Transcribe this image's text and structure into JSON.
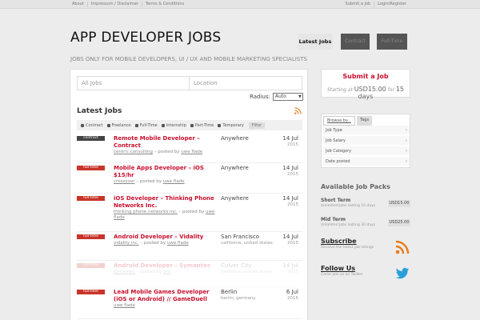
{
  "topbar": {
    "left_links": [
      "About",
      "Impressum / Disclaimer",
      "Terms & Conditions"
    ],
    "right_links": [
      "Submit a Job",
      "Login/Register"
    ]
  },
  "header": {
    "title": "APP DEVELOPER JOBS",
    "tagline": "JOBS ONLY FOR MOBILE DEVELOPERS, UI / UX AND MOBILE MARKETING SPECIALISTS",
    "nav": [
      "Latest Jobs",
      "Contract",
      "Full-Time"
    ]
  },
  "search": {
    "keyword_placeholder": "All Jobs",
    "location_placeholder": "Location",
    "radius_label": "Radius:",
    "radius_value": "Auto"
  },
  "listing": {
    "heading": "Latest Jobs",
    "filters": [
      "Contract",
      "Freelance",
      "Full-Time",
      "Internship",
      "Part-Time",
      "Temporary"
    ],
    "filter_button": "Filter",
    "jobs": [
      {
        "type": "contract",
        "title": "Remote Mobile Developer – Contract",
        "company": "centric consulting",
        "posted_by": "uwe flade",
        "location": "Anywhere",
        "location_detail": "",
        "date": "14 Jul",
        "year": "2015",
        "faded": false
      },
      {
        "type": "full-time",
        "title": "Mobile Apps Developer – iOS $15/hr",
        "company": "crossover",
        "posted_by": "uwe flade",
        "location": "Anywhere",
        "location_detail": "",
        "date": "14 Jul",
        "year": "2015",
        "faded": false
      },
      {
        "type": "full-time",
        "title": "iOS Developer – Thinking Phone Networks Inc.",
        "company": "thinking phone networks inc.",
        "posted_by": "uwe flade",
        "location": "Anywhere",
        "location_detail": "",
        "date": "14 Jul",
        "year": "2015",
        "faded": false
      },
      {
        "type": "full-time",
        "title": "Android Developer – Vidality",
        "company": "vidality inc.",
        "posted_by": "uwe flade",
        "location": "San Francisco",
        "location_detail": "california, united states",
        "date": "14 Jul",
        "year": "2015",
        "faded": false
      },
      {
        "type": "full-time",
        "title": "Android Developer – Symantec",
        "company": "symantec",
        "posted_by": "tim",
        "location": "Culver City",
        "location_detail": "california, united states",
        "date": "14 Jul",
        "year": "2015",
        "faded": true
      },
      {
        "type": "full-time",
        "title": "Lead Mobile Games Developer (iOS or Android) // GameDuell",
        "company": "",
        "posted_by": "uwe flade",
        "location": "Berlin",
        "location_detail": "berlin, germany",
        "date": "6 Jul",
        "year": "2015",
        "faded": false
      }
    ]
  },
  "sidebar": {
    "submit_title": "Submit a Job",
    "submit_starting": "Starting at",
    "submit_price": "USD15.00",
    "submit_for": "for",
    "submit_days": "15 days",
    "browse_tabs": [
      "Browse by...",
      "Tags"
    ],
    "browse_rows": [
      "Job Type",
      "Job Salary",
      "Job Category",
      "Date posted"
    ],
    "packs_heading": "Available Job Packs",
    "packs": [
      {
        "name": "Short Term",
        "desc": "Unlimited Jobs lasting 15 days",
        "price": "USD15.00"
      },
      {
        "name": "Mid Term",
        "desc": "Unlimited Jobs lasting 30 days",
        "price": "USD25.00"
      }
    ],
    "subscribe_heading": "Subscribe",
    "subscribe_desc": "Receive the latest job listings",
    "follow_heading": "Follow Us",
    "follow_desc": "Come join us on Twitter"
  },
  "colors": {
    "accent": "#c8102e",
    "fulltime_badge": "#c8342a",
    "contract_badge": "#444444",
    "rss": "#e87d1e",
    "twitter": "#2a9fd8"
  }
}
